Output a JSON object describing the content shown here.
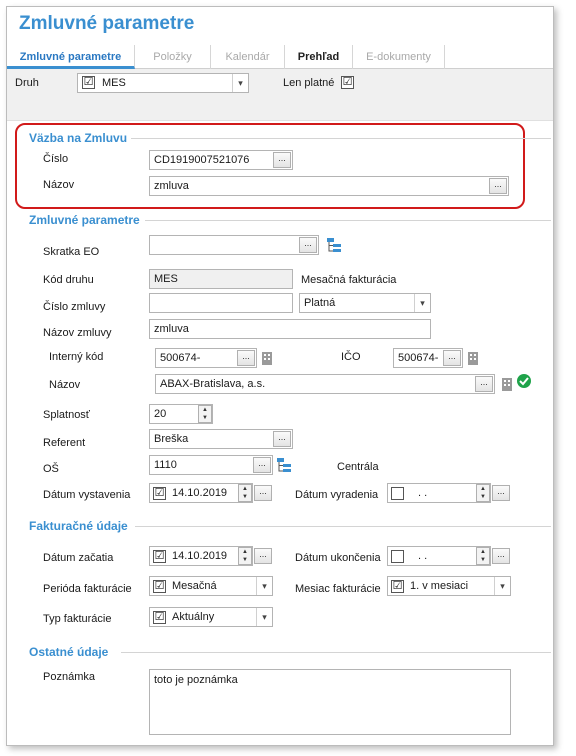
{
  "window": {
    "title": "Zmluvné parametre"
  },
  "tabs": [
    "Zmluvné parametre",
    "Položky",
    "Kalendár",
    "Prehľad",
    "E-dokumenty"
  ],
  "toolbar": {
    "druh_label": "Druh",
    "druh_value": "MES",
    "len_platne_label": "Len platné",
    "len_platne_checked": "☑"
  },
  "vazba": {
    "title": "Väzba na Zmluvu",
    "cislo_label": "Číslo",
    "cislo_value": "CD1919007521076",
    "nazov_label": "Názov",
    "nazov_value": "zmluva"
  },
  "zmluvne": {
    "title": "Zmluvné parametre",
    "skratka_label": "Skratka EO",
    "skratka_value": "",
    "kod_druhu_label": "Kód druhu",
    "kod_druhu_value": "MES",
    "kod_druhu_desc": "Mesačná fakturácia",
    "cislo_zmluvy_label": "Číslo zmluvy",
    "cislo_zmluvy_value": "",
    "stav_value": "Platná",
    "nazov_zmluvy_label": "Názov zmluvy",
    "nazov_zmluvy_value": "zmluva",
    "interny_kod_label": "Interný kód",
    "interny_kod_value": "500674-",
    "ico_label": "IČO",
    "ico_value": "500674-",
    "nazov_label": "Názov",
    "nazov_value": "ABAX-Bratislava, a.s.",
    "splatnost_label": "Splatnosť",
    "splatnost_value": "20",
    "referent_label": "Referent",
    "referent_value": "Breška",
    "os_label": "OŠ",
    "os_value": "1110",
    "os_desc": "Centrála",
    "datum_vystavenia_label": "Dátum vystavenia",
    "datum_vystavenia_value": "14.10.2019",
    "datum_vyradenia_label": "Dátum vyradenia",
    "datum_vyradenia_value": ".   ."
  },
  "fakturacne": {
    "title": "Fakturačné údaje",
    "datum_zacatia_label": "Dátum začatia",
    "datum_zacatia_value": "14.10.2019",
    "datum_ukoncenia_label": "Dátum ukončenia",
    "datum_ukoncenia_value": ".   .",
    "perioda_label": "Perióda fakturácie",
    "perioda_value": "Mesačná",
    "mesiac_label": "Mesiac fakturácie",
    "mesiac_value": "1. v mesiaci",
    "typ_label": "Typ fakturácie",
    "typ_value": "Aktuálny"
  },
  "ostatne": {
    "title": "Ostatné údaje",
    "poznamka_label": "Poznámka",
    "poznamka_value": "toto je poznámka"
  },
  "buttons": {
    "ellipsis": "...",
    "dropdown": "▾",
    "up": "▲",
    "down": "▼",
    "checkmark": "✓"
  },
  "colors": {
    "accent": "#3a8fd0",
    "highlight": "#d11a1a",
    "ok": "#1fa34a"
  }
}
